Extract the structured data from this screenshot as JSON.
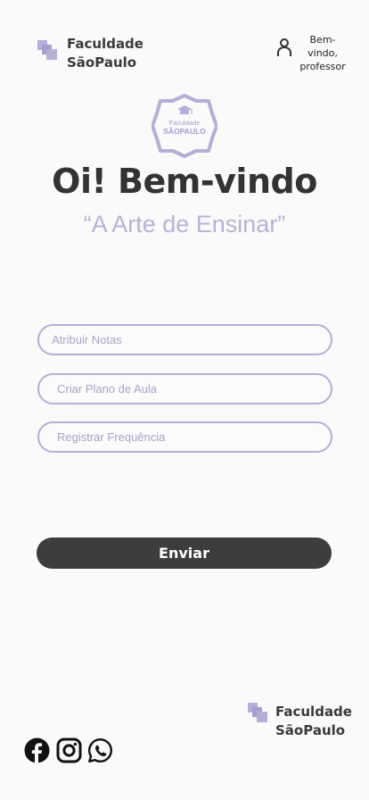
{
  "header": {
    "brand_line1": "Faculdade",
    "brand_line2": "SãoPaulo",
    "user_line1": "Bem-vindo,",
    "user_line2": "professor"
  },
  "seal": {
    "line1": "Faculdade",
    "line2": "SÃOPAULO"
  },
  "hero": {
    "title": "Oi! Bem-vindo",
    "subtitle": "“A Arte de Ensinar”"
  },
  "form": {
    "field1_placeholder": "Atribuir Notas",
    "field2_placeholder": "Criar Plano de Aula",
    "field3_placeholder": "Registrar Frequência",
    "submit_label": "Enviar"
  },
  "footer": {
    "brand_line1": "Faculdade",
    "brand_line2": "SãoPaulo",
    "social": [
      "facebook-icon",
      "instagram-icon",
      "whatsapp-icon"
    ]
  },
  "colors": {
    "accent": "#b9b2d8",
    "text_dark": "#333333",
    "button": "#3d3d3d",
    "background": "#fafafa"
  }
}
